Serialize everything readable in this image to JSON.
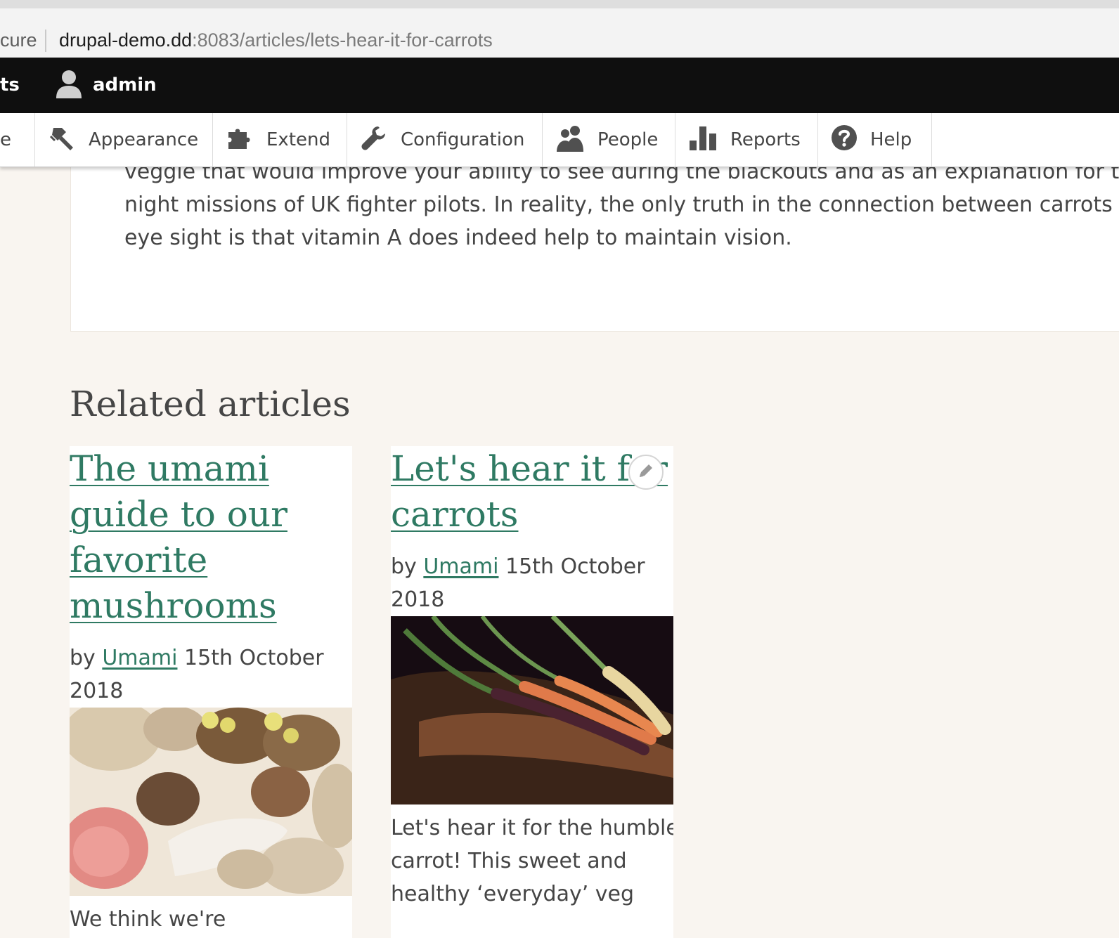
{
  "browser": {
    "url_prefix": "cure",
    "url_host": "drupal-demo.dd",
    "url_path": ":8083/articles/lets-hear-it-for-carrots"
  },
  "admin_bar": {
    "clipped_label": "ts",
    "user_label": "admin"
  },
  "tray": {
    "clipped_label": "e",
    "items": [
      {
        "label": "Appearance",
        "icon": "paint-roller-icon"
      },
      {
        "label": "Extend",
        "icon": "puzzle-icon"
      },
      {
        "label": "Configuration",
        "icon": "wrench-icon"
      },
      {
        "label": "People",
        "icon": "people-icon"
      },
      {
        "label": "Reports",
        "icon": "bar-chart-icon"
      },
      {
        "label": "Help",
        "icon": "help-icon"
      }
    ]
  },
  "article": {
    "lines": [
      "veggie that would improve your ability to see during the blackouts and as an explanation for the",
      "night missions of UK fighter pilots. In reality, the only truth in the connection between carrots and",
      "eye sight is that vitamin A does indeed help to maintain vision."
    ]
  },
  "related": {
    "heading": "Related articles",
    "cards": [
      {
        "title_lines": [
          "The umami",
          "guide to our",
          "favorite",
          "mushrooms"
        ],
        "by": "by",
        "author": "Umami",
        "date_line1": "15th October",
        "date_line2": "2018",
        "summary_lines": [
          "We think we're"
        ]
      },
      {
        "title_lines": [
          "Let's hear it for",
          "carrots"
        ],
        "by": "by",
        "author": "Umami",
        "date_line1": "15th October",
        "date_line2": "2018",
        "summary_lines": [
          "Let's hear it for the humble",
          "carrot! This sweet and",
          "healthy ‘everyday’ veg"
        ]
      }
    ]
  },
  "colors": {
    "link": "#2f7a63",
    "page_bg": "#f9f5f0",
    "admin_bar": "#0f0f0f"
  }
}
